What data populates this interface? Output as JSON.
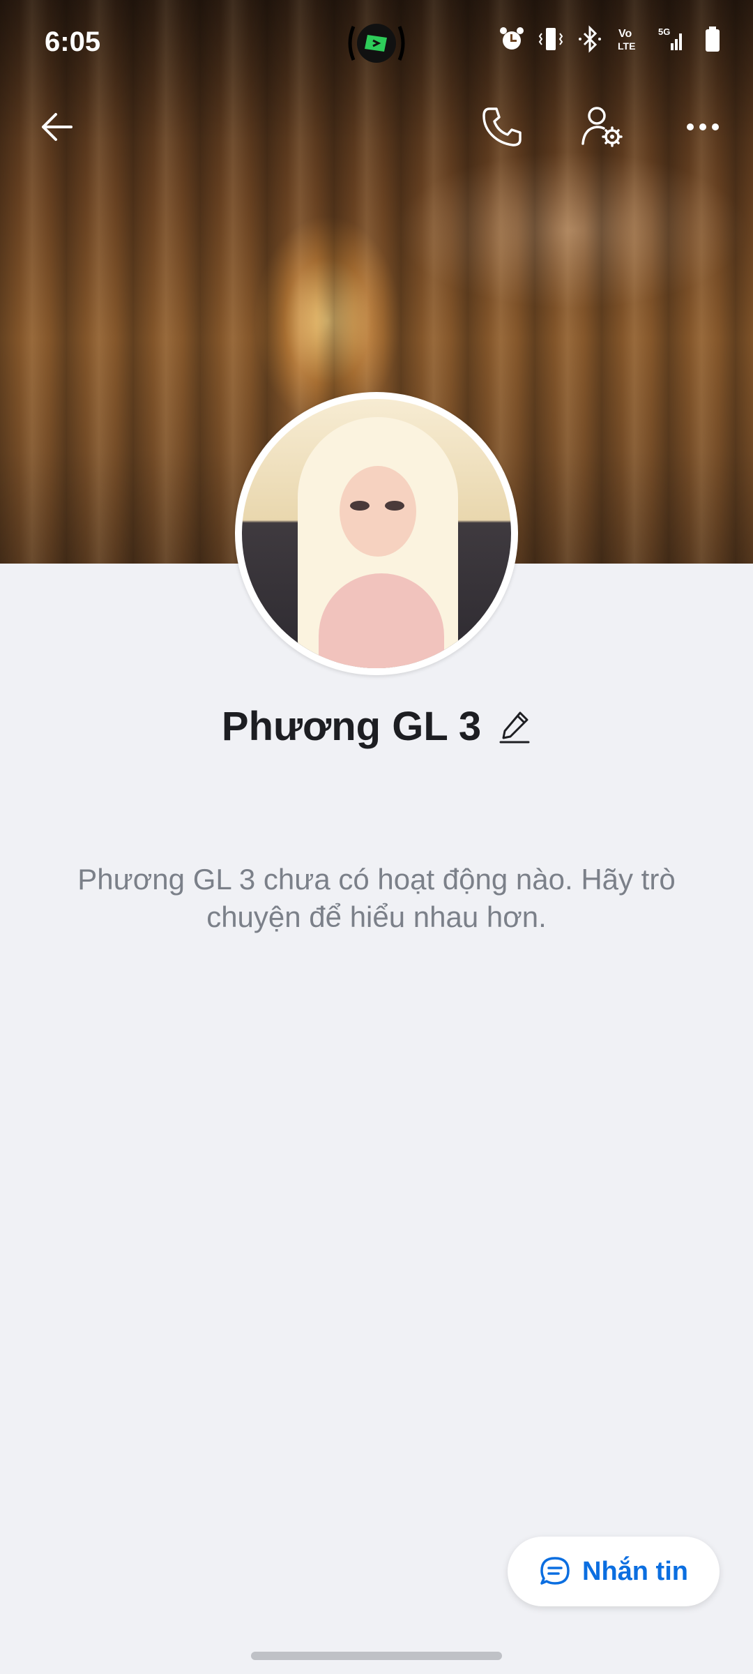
{
  "status_bar": {
    "time": "6:05",
    "center_icon": "app-notification-icon",
    "icons": [
      "alarm-icon",
      "vibrate-icon",
      "bluetooth-icon",
      "volte-icon",
      "5g-signal-icon",
      "battery-icon"
    ]
  },
  "top_bar": {
    "back_icon": "arrow-left-icon",
    "call_icon": "phone-icon",
    "profile_settings_icon": "user-gear-icon",
    "more_icon": "more-horizontal-icon"
  },
  "profile": {
    "name": "Phương GL 3",
    "edit_icon": "pencil-icon",
    "empty_activity_message": "Phương GL 3 chưa có hoạt động nào. Hãy trò chuyện để hiểu nhau hơn."
  },
  "message_button": {
    "label": "Nhắn tin",
    "icon": "chat-bubble-icon",
    "color": "#0b6ee0"
  },
  "colors": {
    "background": "#f0f1f5",
    "name_text": "#1d1e22",
    "secondary_text": "#7b8089"
  }
}
